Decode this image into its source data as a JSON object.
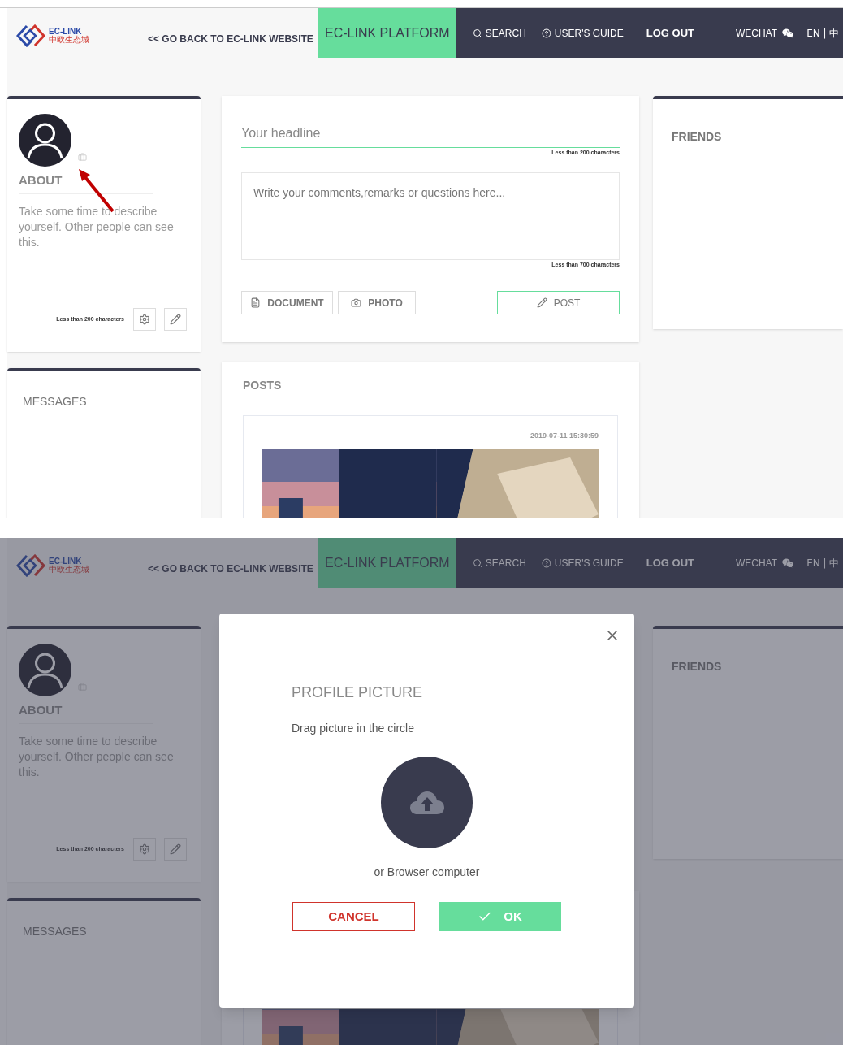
{
  "screens": [
    {
      "header": {
        "logo": {
          "name": "EC-LINK",
          "subtitle": "中欧生态城"
        },
        "back_link": "<< GO BACK TO EC-LINK WEBSITE",
        "platform_tab": {
          "label": "EC-LINK PLATFORM",
          "selected": true
        },
        "nav": [
          {
            "label": "SEARCH",
            "kind": "search"
          },
          {
            "label": "USER'S GUIDE",
            "kind": "help"
          },
          {
            "label": "LOG OUT",
            "kind": "bold"
          },
          {
            "label": "WECHAT",
            "kind": "wechat"
          },
          {
            "label": "EN | 中",
            "kind": "plain"
          }
        ]
      },
      "about": {
        "title": "ABOUT",
        "description": "Take some time to describe yourself. Other people can see this.",
        "hint": "Less than 200 characters"
      },
      "annotation": {
        "kind": "arrow"
      },
      "composer": {
        "headline_placeholder": "Your headline",
        "headline_hint": "Less than 200 characters",
        "comment_placeholder": "Write your comments,remarks or questions here...",
        "comment_hint": "Less than 700 characters",
        "buttons": [
          {
            "label": "DOCUMENT",
            "kind": "document"
          },
          {
            "label": "PHOTO"
          },
          {
            "label": "POST",
            "kind": "post"
          }
        ]
      },
      "friends": {
        "title": "FRIENDS"
      },
      "messages": {
        "title": "MESSAGES"
      },
      "posts": {
        "title": "POSTS",
        "items": [
          {
            "date": "2019-07-11 15:30:59"
          }
        ]
      }
    },
    {
      "header": {
        "logo": {
          "name": "EC-LINK",
          "subtitle": "中欧生态城"
        },
        "back_link": "<< GO BACK TO EC-LINK WEBSITE",
        "platform_tab": {
          "label": "EC-LINK PLATFORM",
          "selected": true
        },
        "nav": [
          {
            "label": "SEARCH",
            "kind": "search"
          },
          {
            "label": "USER'S GUIDE",
            "kind": "help"
          },
          {
            "label": "LOG OUT",
            "kind": "bold"
          },
          {
            "label": "WECHAT",
            "kind": "wechat"
          },
          {
            "label": "EN | 中",
            "kind": "plain"
          }
        ]
      },
      "about": {
        "title": "ABOUT",
        "description": "Take some time to describe yourself. Other people can see this.",
        "hint": "Less than 200 characters"
      },
      "friends": {
        "title": "FRIENDS"
      },
      "messages": {
        "title": "MESSAGES"
      },
      "modal": {
        "title": "PROFILE PICTURE",
        "instruction": "Drag picture in the circle",
        "browse_text": "or Browser computer",
        "buttons": [
          {
            "label": "CANCEL",
            "kind": "cancel"
          },
          {
            "label": "OK",
            "kind": "ok"
          }
        ]
      }
    }
  ]
}
